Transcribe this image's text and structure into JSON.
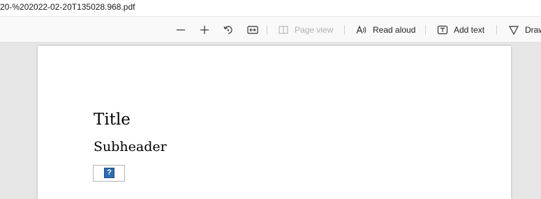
{
  "window": {
    "title": "20-%202022-02-20T135028.968.pdf"
  },
  "toolbar": {
    "zoom_out_icon": "minus-icon",
    "zoom_in_icon": "plus-icon",
    "rotate_icon": "rotate-icon",
    "fit_icon": "fit-width-icon",
    "page_view_label": "Page view",
    "read_aloud_label": "Read aloud",
    "add_text_label": "Add text",
    "draw_label": "Draw"
  },
  "document": {
    "title": "Title",
    "subheader": "Subheader",
    "image_placeholder": "?"
  }
}
